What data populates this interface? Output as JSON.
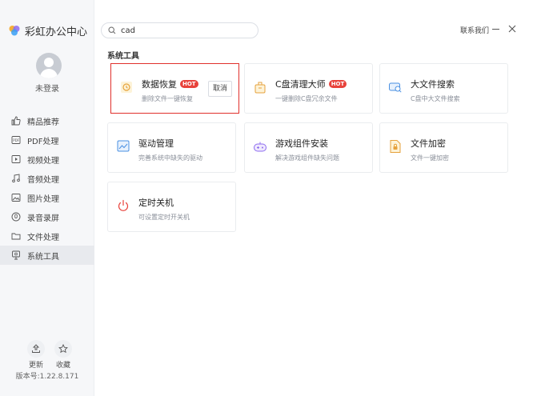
{
  "app": {
    "logo_text": "彩虹办公中心"
  },
  "user": {
    "login_status": "未登录"
  },
  "nav": {
    "items": [
      {
        "label": "精品推荐",
        "icon": "thumbs-up-icon"
      },
      {
        "label": "PDF处理",
        "icon": "pdf-icon"
      },
      {
        "label": "视频处理",
        "icon": "video-icon"
      },
      {
        "label": "音频处理",
        "icon": "music-note-icon"
      },
      {
        "label": "图片处理",
        "icon": "image-icon"
      },
      {
        "label": "录音录屏",
        "icon": "record-icon"
      },
      {
        "label": "文件处理",
        "icon": "folder-icon"
      },
      {
        "label": "系统工具",
        "icon": "monitor-icon",
        "active": true
      }
    ]
  },
  "footer": {
    "update_label": "更新",
    "favorite_label": "收藏",
    "version": "版本号:1.22.8.171"
  },
  "header": {
    "search_value": "cad",
    "contact_label": "联系我们"
  },
  "section": {
    "title": "系统工具"
  },
  "tools": [
    {
      "title": "数据恢复",
      "desc": "删除文件一键恢复",
      "badge": "HOT",
      "action": "取消",
      "icon": "data-recovery-icon"
    },
    {
      "title": "C盘清理大师",
      "desc": "一键删除C盘冗余文件",
      "badge": "HOT",
      "icon": "cleanup-icon"
    },
    {
      "title": "大文件搜索",
      "desc": "C盘中大文件搜索",
      "icon": "file-search-icon"
    },
    {
      "title": "驱动管理",
      "desc": "完善系统中缺失的驱动",
      "icon": "driver-icon"
    },
    {
      "title": "游戏组件安装",
      "desc": "解决游戏组件缺失问题",
      "icon": "gamepad-icon"
    },
    {
      "title": "文件加密",
      "desc": "文件一键加密",
      "icon": "lock-file-icon"
    },
    {
      "title": "定时关机",
      "desc": "可设置定时开关机",
      "icon": "power-icon"
    }
  ],
  "colors": {
    "accent_red": "#e8423b",
    "highlight_border": "#e0302c"
  }
}
